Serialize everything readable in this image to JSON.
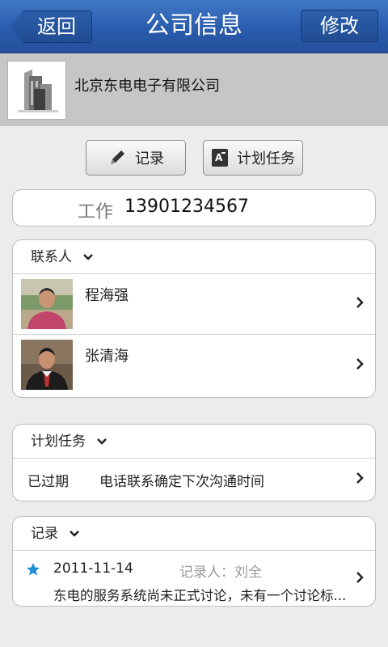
{
  "header": {
    "title": "公司信息",
    "back_label": "返回",
    "edit_label": "修改"
  },
  "company": {
    "name": "北京东电电子有限公司",
    "logo_icon": "building-icon"
  },
  "actions": {
    "record_label": "记录",
    "record_icon": "pencil-icon",
    "plan_label": "计划任务",
    "plan_icon": "task-icon"
  },
  "phone": {
    "label": "工作",
    "number": "13901234567"
  },
  "contacts": {
    "title": "联系人",
    "items": [
      {
        "name": "程海强"
      },
      {
        "name": "张清海"
      }
    ]
  },
  "tasks": {
    "title": "计划任务",
    "items": [
      {
        "status": "已过期",
        "desc": "电话联系确定下次沟通时间"
      }
    ]
  },
  "records": {
    "title": "记录",
    "items": [
      {
        "date": "2011-11-14",
        "author": "记录人：刘全",
        "content": "东电的服务系统尚未正式讨论，未有一个讨论标..."
      }
    ]
  },
  "colors": {
    "header": "#2a5cad",
    "star": "#1e90d6",
    "band": "#c6c6c6"
  }
}
